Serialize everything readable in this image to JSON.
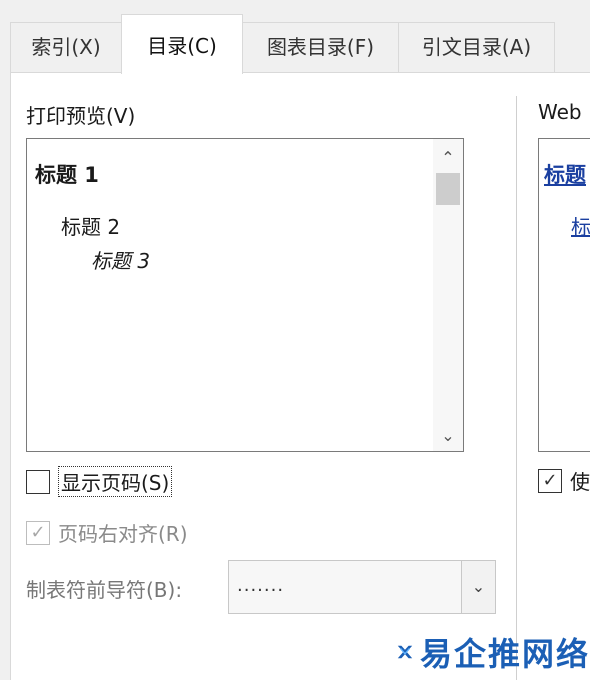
{
  "tabs": [
    {
      "label": "索引(X)"
    },
    {
      "label": "目录(C)"
    },
    {
      "label": "图表目录(F)"
    },
    {
      "label": "引文目录(A)"
    }
  ],
  "print_preview": {
    "label": "打印预览(V)",
    "headings": [
      "标题 1",
      "标题 2",
      "标题 3"
    ]
  },
  "options": {
    "show_page_numbers": {
      "label": "显示页码(S)",
      "checked": false
    },
    "right_align_page_numbers": {
      "label": "页码右对齐(R)",
      "checked": true,
      "disabled": true
    },
    "tab_leader": {
      "label": "制表符前导符(B):",
      "value": "......."
    }
  },
  "web_preview": {
    "label": "Web",
    "headings": [
      "标题",
      "标"
    ],
    "checkbox_label": "使"
  },
  "watermark": {
    "text": "易企推网络"
  },
  "icons": {
    "scroll_up": "chevron-up-icon",
    "scroll_down": "chevron-down-icon",
    "dropdown": "chevron-down-icon",
    "check": "checkmark-icon"
  },
  "colors": {
    "link": "#1a3fa0",
    "watermark": "#1b5fb5"
  }
}
